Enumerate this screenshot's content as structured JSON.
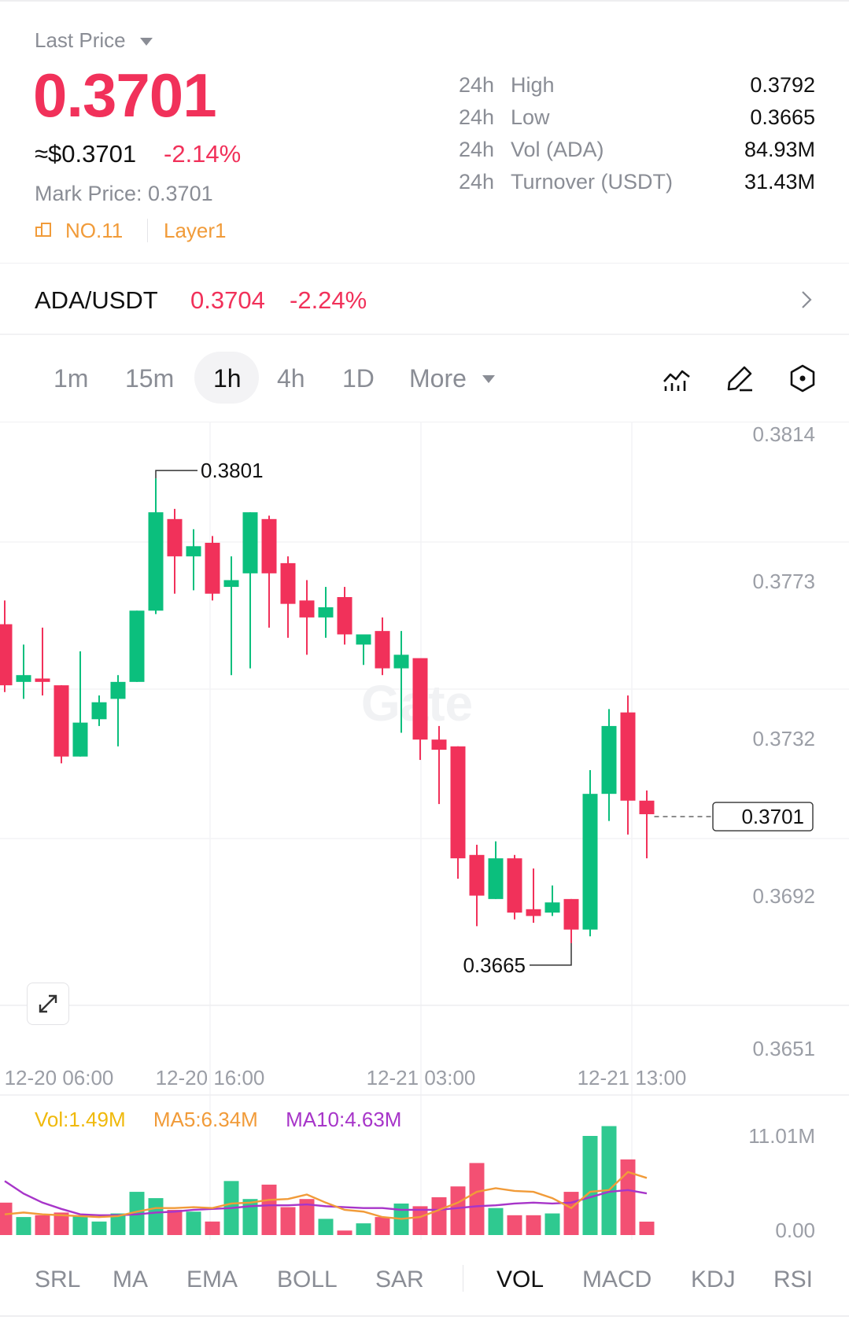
{
  "header": {
    "last_price_label": "Last Price",
    "last_price": "0.3701",
    "usd_price": "≈$0.3701",
    "change_pct": "-2.14%",
    "mark_price_label": "Mark Price: 0.3701",
    "rank": "NO.11",
    "tag": "Layer1"
  },
  "stats": [
    {
      "period": "24h",
      "label": "High",
      "value": "0.3792"
    },
    {
      "period": "24h",
      "label": "Low",
      "value": "0.3665"
    },
    {
      "period": "24h",
      "label": "Vol (ADA)",
      "value": "84.93M"
    },
    {
      "period": "24h",
      "label": "Turnover (USDT)",
      "value": "31.43M"
    }
  ],
  "pair": {
    "name": "ADA/USDT",
    "price": "0.3704",
    "change": "-2.24%"
  },
  "timeframes": [
    "1m",
    "15m",
    "1h",
    "4h",
    "1D",
    "More"
  ],
  "active_timeframe": "1h",
  "volume_legend": {
    "vol": "Vol:1.49M",
    "ma5": "MA5:6.34M",
    "ma10": "MA10:4.63M"
  },
  "indicator_tabs": [
    "SRL",
    "MA",
    "EMA",
    "BOLL",
    "SAR",
    "VOL",
    "MACD",
    "KDJ",
    "RSI"
  ],
  "active_indicator": "VOL",
  "colors": {
    "up": "#0bbf7d",
    "down": "#f1315a",
    "ma5": "#f19b39",
    "ma10": "#a735c9",
    "vol_legend": "#f0b90b"
  },
  "chart_data": {
    "type": "candlestick",
    "y_ticks": [
      "0.3814",
      "0.3773",
      "0.3732",
      "0.3692",
      "0.3651"
    ],
    "x_ticks": [
      "12-20 06:00",
      "12-20 16:00",
      "12-21 03:00",
      "12-21 13:00"
    ],
    "ylim": [
      0.3651,
      0.3814
    ],
    "current_price_label": "0.3701",
    "max_label": "0.3801",
    "min_label": "0.3665",
    "candles": [
      {
        "o": 0.3758,
        "h": 0.3765,
        "l": 0.3738,
        "c": 0.374
      },
      {
        "o": 0.3741,
        "h": 0.3752,
        "l": 0.3736,
        "c": 0.3743
      },
      {
        "o": 0.3742,
        "h": 0.3757,
        "l": 0.3737,
        "c": 0.3741
      },
      {
        "o": 0.374,
        "h": 0.374,
        "l": 0.3717,
        "c": 0.3719
      },
      {
        "o": 0.3719,
        "h": 0.375,
        "l": 0.3719,
        "c": 0.3729
      },
      {
        "o": 0.373,
        "h": 0.3737,
        "l": 0.3728,
        "c": 0.3735
      },
      {
        "o": 0.3736,
        "h": 0.3743,
        "l": 0.3722,
        "c": 0.3741
      },
      {
        "o": 0.3741,
        "h": 0.3762,
        "l": 0.3741,
        "c": 0.3762
      },
      {
        "o": 0.3762,
        "h": 0.3801,
        "l": 0.3761,
        "c": 0.3791
      },
      {
        "o": 0.3789,
        "h": 0.3792,
        "l": 0.3767,
        "c": 0.3778
      },
      {
        "o": 0.3778,
        "h": 0.3786,
        "l": 0.3768,
        "c": 0.3781
      },
      {
        "o": 0.3782,
        "h": 0.3784,
        "l": 0.3765,
        "c": 0.3767
      },
      {
        "o": 0.3769,
        "h": 0.3778,
        "l": 0.3743,
        "c": 0.3771
      },
      {
        "o": 0.3773,
        "h": 0.3791,
        "l": 0.3745,
        "c": 0.3791
      },
      {
        "o": 0.3789,
        "h": 0.379,
        "l": 0.3757,
        "c": 0.3773
      },
      {
        "o": 0.3776,
        "h": 0.3778,
        "l": 0.3754,
        "c": 0.3764
      },
      {
        "o": 0.3765,
        "h": 0.3771,
        "l": 0.3749,
        "c": 0.376
      },
      {
        "o": 0.376,
        "h": 0.3769,
        "l": 0.3754,
        "c": 0.3763
      },
      {
        "o": 0.3766,
        "h": 0.3769,
        "l": 0.3752,
        "c": 0.3755
      },
      {
        "o": 0.3752,
        "h": 0.3754,
        "l": 0.3746,
        "c": 0.3755
      },
      {
        "o": 0.3756,
        "h": 0.376,
        "l": 0.3743,
        "c": 0.3745
      },
      {
        "o": 0.3745,
        "h": 0.3756,
        "l": 0.3726,
        "c": 0.3749
      },
      {
        "o": 0.3748,
        "h": 0.3747,
        "l": 0.3718,
        "c": 0.3724
      },
      {
        "o": 0.3724,
        "h": 0.3728,
        "l": 0.3705,
        "c": 0.3721
      },
      {
        "o": 0.3722,
        "h": 0.3722,
        "l": 0.3683,
        "c": 0.3689
      },
      {
        "o": 0.369,
        "h": 0.3693,
        "l": 0.3669,
        "c": 0.3678
      },
      {
        "o": 0.3677,
        "h": 0.3694,
        "l": 0.3677,
        "c": 0.3689
      },
      {
        "o": 0.3689,
        "h": 0.369,
        "l": 0.3671,
        "c": 0.3673
      },
      {
        "o": 0.3674,
        "h": 0.3686,
        "l": 0.367,
        "c": 0.3672
      },
      {
        "o": 0.3673,
        "h": 0.3681,
        "l": 0.3672,
        "c": 0.3676
      },
      {
        "o": 0.3677,
        "h": 0.3677,
        "l": 0.3664,
        "c": 0.3668
      },
      {
        "o": 0.3668,
        "h": 0.3715,
        "l": 0.3666,
        "c": 0.3708
      },
      {
        "o": 0.3708,
        "h": 0.3733,
        "l": 0.37,
        "c": 0.3728
      },
      {
        "o": 0.3732,
        "h": 0.3737,
        "l": 0.3696,
        "c": 0.3706
      },
      {
        "o": 0.3706,
        "h": 0.3709,
        "l": 0.3689,
        "c": 0.3702
      }
    ],
    "volume": {
      "y_ticks": [
        "11.01M",
        "0.00"
      ],
      "ylim": [
        0,
        11.01
      ],
      "values": [
        3.6,
        2.0,
        2.2,
        2.5,
        2.2,
        1.5,
        2.4,
        4.8,
        4.1,
        2.8,
        2.6,
        1.5,
        6.0,
        4.0,
        5.6,
        3.1,
        4.0,
        1.8,
        0.5,
        1.3,
        2.0,
        3.5,
        3.2,
        4.2,
        5.4,
        8.0,
        3.0,
        2.2,
        2.2,
        2.4,
        4.8,
        11.01,
        12.1,
        8.4,
        1.49
      ],
      "ma5": [
        2.3,
        2.5,
        2.3,
        2.2,
        2.1,
        2.0,
        2.1,
        2.6,
        3.0,
        3.0,
        3.1,
        3.0,
        3.5,
        3.6,
        3.9,
        4.0,
        4.5,
        3.6,
        2.8,
        2.6,
        2.0,
        1.8,
        2.0,
        2.8,
        3.6,
        4.8,
        5.2,
        4.9,
        4.8,
        4.1,
        3.0,
        4.8,
        5.0,
        7.0,
        6.34
      ],
      "ma10": [
        6.0,
        4.6,
        3.6,
        2.9,
        2.3,
        2.2,
        2.2,
        2.3,
        2.5,
        2.6,
        2.8,
        2.9,
        3.0,
        3.2,
        3.3,
        3.3,
        3.4,
        3.2,
        3.1,
        3.0,
        3.0,
        2.8,
        2.8,
        2.8,
        3.0,
        3.2,
        3.3,
        3.5,
        3.6,
        3.5,
        3.6,
        4.2,
        4.8,
        5.0,
        4.63
      ]
    }
  }
}
